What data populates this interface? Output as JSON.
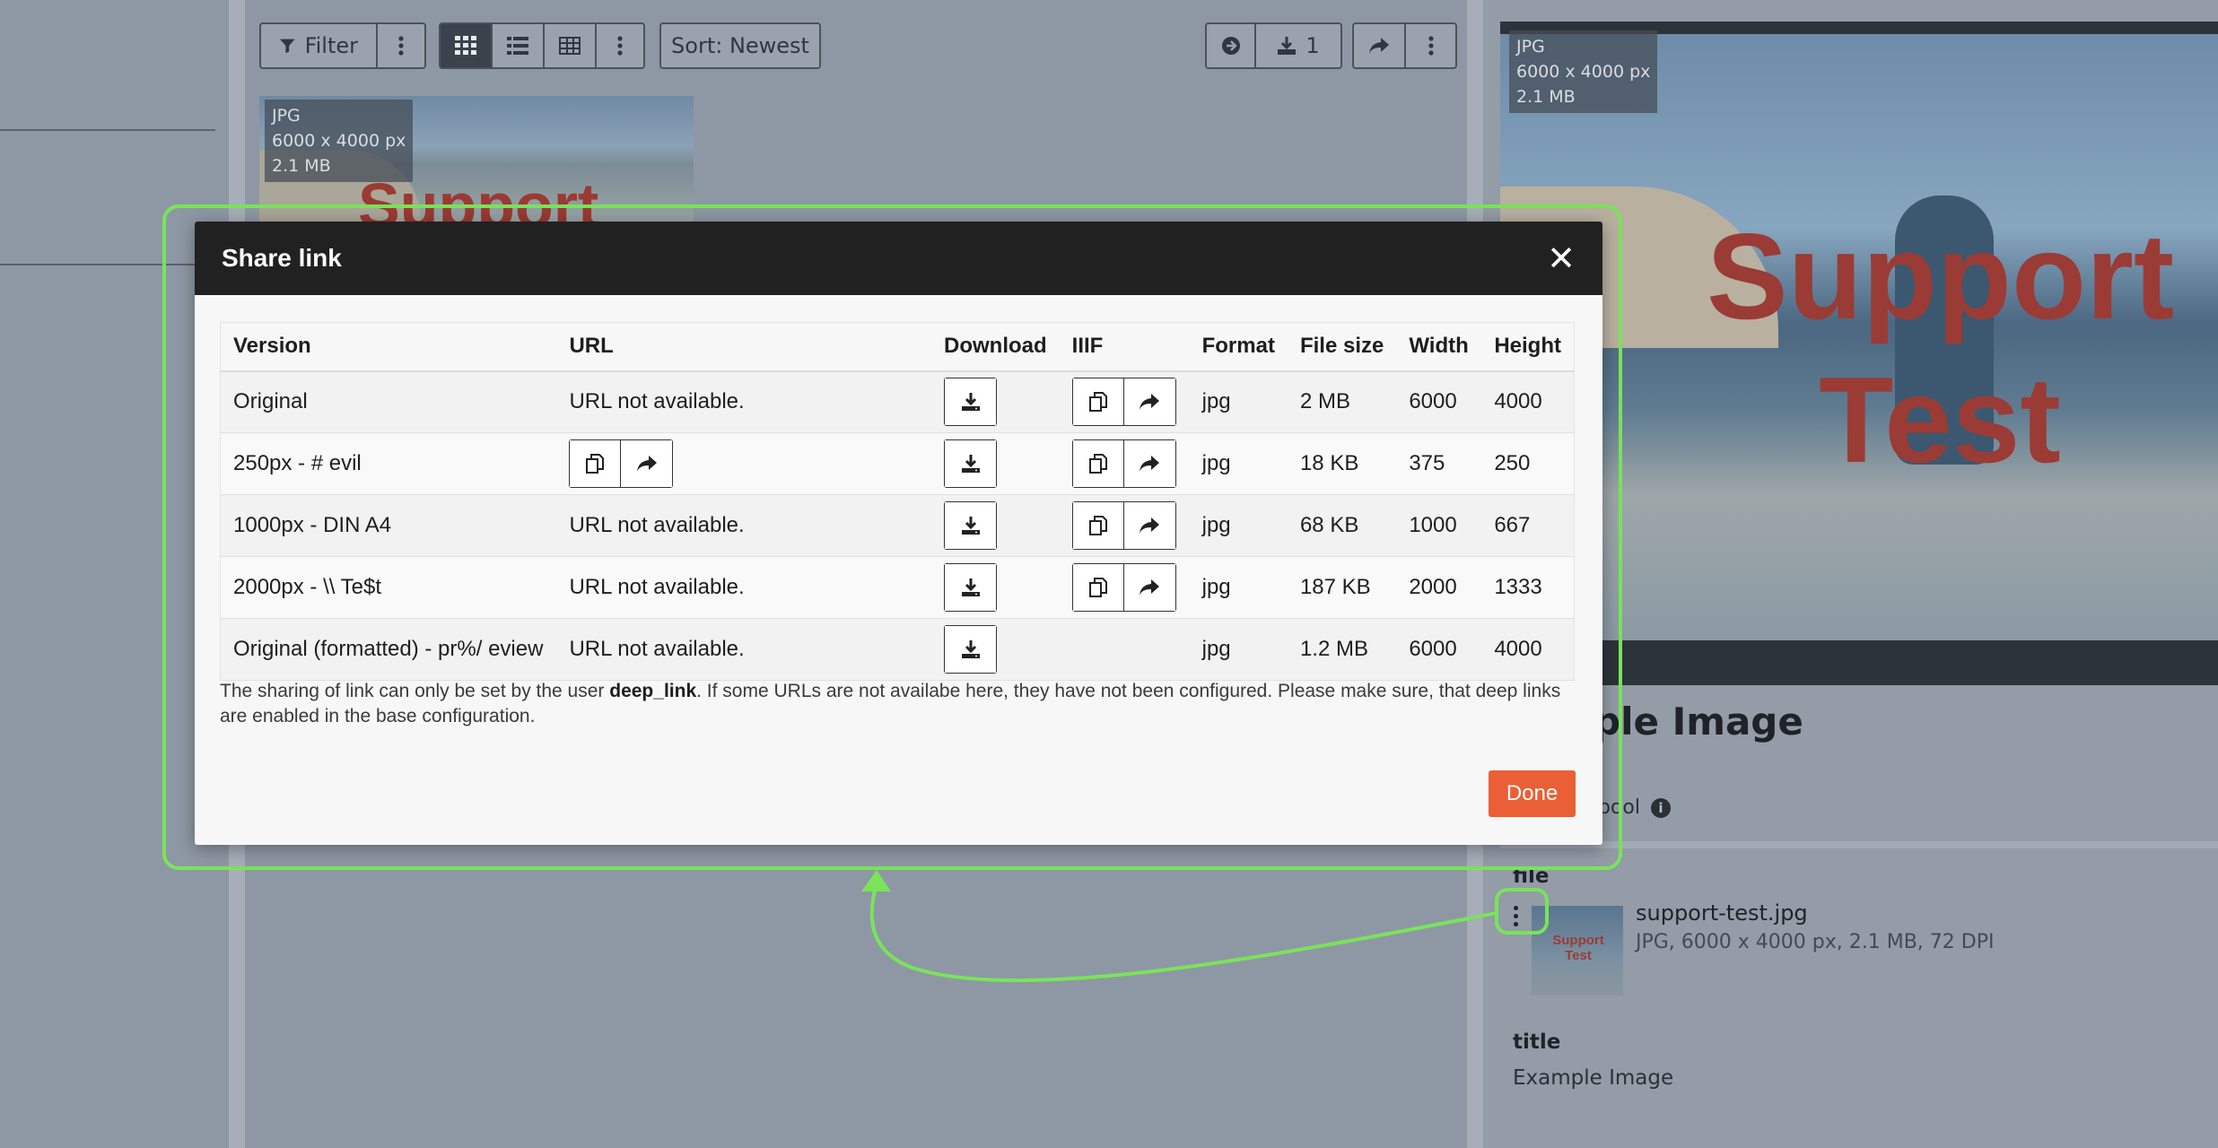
{
  "toolbar": {
    "filter_label": "Filter",
    "sort_label": "Sort: Newest",
    "download_count": "1"
  },
  "thumbnail": {
    "format": "JPG",
    "dimensions": "6000 x 4000 px",
    "size": "2.1 MB",
    "watermark": "Support"
  },
  "preview": {
    "format": "JPG",
    "dimensions": "6000 x 4000 px",
    "size": "2.1 MB",
    "watermark_line1": "Support",
    "watermark_line2": "Test"
  },
  "details": {
    "title_partial": "ple Image",
    "pool_partial": "d pool",
    "info_icon": "i",
    "file_label": "file",
    "file_name": "support-test.jpg",
    "file_meta": "JPG, 6000 x 4000 px, 2.1 MB, 72 DPI",
    "file_thumb_watermark": "Support Test",
    "title_label": "title",
    "title_value": "Example Image"
  },
  "modal": {
    "title": "Share link",
    "close_glyph": "✕",
    "columns": {
      "version": "Version",
      "url": "URL",
      "download": "Download",
      "iiif": "IIIF",
      "format": "Format",
      "file_size": "File size",
      "width": "Width",
      "height": "Height"
    },
    "rows": [
      {
        "version": "Original",
        "url": "URL not available.",
        "format": "jpg",
        "file_size": "2 MB",
        "width": "6000",
        "height": "4000"
      },
      {
        "version": "250px - # evil",
        "url": "",
        "format": "jpg",
        "file_size": "18 KB",
        "width": "375",
        "height": "250"
      },
      {
        "version": "1000px - DIN A4",
        "url": "URL not available.",
        "format": "jpg",
        "file_size": "68 KB",
        "width": "1000",
        "height": "667"
      },
      {
        "version": "2000px - \\\\ Te$t",
        "url": "URL not available.",
        "format": "jpg",
        "file_size": "187 KB",
        "width": "2000",
        "height": "1333"
      },
      {
        "version": "Original (formatted) - pr%/ eview",
        "url": "URL not available.",
        "format": "jpg",
        "file_size": "1.2 MB",
        "width": "6000",
        "height": "4000"
      }
    ],
    "note_before": "The sharing of link can only be set by the user ",
    "note_user": "deep_link",
    "note_after": ". If some URLs are not availabe here, they have not been configured. Please make sure, that deep links are enabled in the base configuration.",
    "done_label": "Done"
  },
  "colors": {
    "accent_done": "#ea5f35",
    "highlight": "#7ae35a",
    "modal_header": "#212121"
  },
  "icons": {
    "download": "download-icon",
    "copy": "copy-icon",
    "share": "share-icon",
    "close": "close-icon",
    "kebab": "kebab-icon"
  }
}
